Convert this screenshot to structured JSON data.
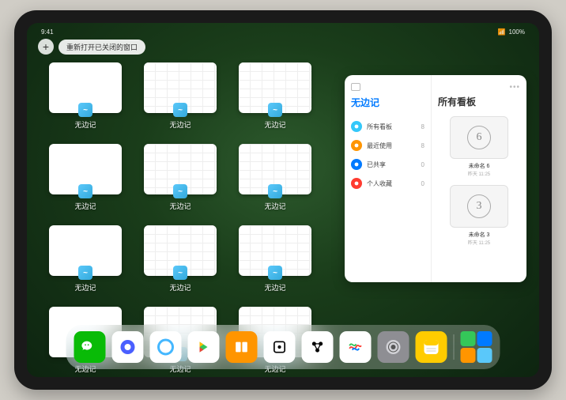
{
  "status": {
    "time": "9:41",
    "battery": "100%"
  },
  "top": {
    "plus": "+",
    "reopen_label": "重新打开已关闭的窗口"
  },
  "app_name": "无边记",
  "windows": [
    {
      "label": "无边记",
      "style": "blank"
    },
    {
      "label": "无边记",
      "style": "calendar"
    },
    {
      "label": "无边记",
      "style": "calendar"
    },
    {
      "label": "无边记",
      "style": "blank"
    },
    {
      "label": "无边记",
      "style": "calendar"
    },
    {
      "label": "无边记",
      "style": "calendar"
    },
    {
      "label": "无边记",
      "style": "blank"
    },
    {
      "label": "无边记",
      "style": "calendar"
    },
    {
      "label": "无边记",
      "style": "calendar"
    },
    {
      "label": "无边记",
      "style": "blank"
    },
    {
      "label": "无边记",
      "style": "calendar"
    },
    {
      "label": "无边记",
      "style": "calendar"
    }
  ],
  "panel": {
    "title": "无边记",
    "right_title": "所有看板",
    "categories": [
      {
        "label": "所有看板",
        "count": "8",
        "color": "#34c8fa"
      },
      {
        "label": "最近使用",
        "count": "8",
        "color": "#ff9500"
      },
      {
        "label": "已共享",
        "count": "0",
        "color": "#007aff"
      },
      {
        "label": "个人收藏",
        "count": "0",
        "color": "#ff3b30"
      }
    ],
    "boards": [
      {
        "name": "未命名 6",
        "date": "昨天 11:25",
        "glyph": "6"
      },
      {
        "name": "未命名 3",
        "date": "昨天 11:25",
        "glyph": "3"
      }
    ]
  },
  "dock": [
    {
      "name": "wechat",
      "bg": "#09bb07",
      "glyph": "💬"
    },
    {
      "name": "quark",
      "bg": "#ffffff",
      "glyph": "◉"
    },
    {
      "name": "qqbrowser",
      "bg": "#ffffff",
      "glyph": "◯"
    },
    {
      "name": "play",
      "bg": "#ffffff",
      "glyph": "▶"
    },
    {
      "name": "books",
      "bg": "#ff9500",
      "glyph": "📖"
    },
    {
      "name": "dice",
      "bg": "#ffffff",
      "glyph": "⚀"
    },
    {
      "name": "connect",
      "bg": "#ffffff",
      "glyph": "⋈"
    },
    {
      "name": "freeform",
      "bg": "#ffffff",
      "glyph": "〰"
    },
    {
      "name": "settings",
      "bg": "#8e8e93",
      "glyph": "⚙"
    },
    {
      "name": "notes",
      "bg": "#ffcc00",
      "glyph": "📝"
    }
  ]
}
